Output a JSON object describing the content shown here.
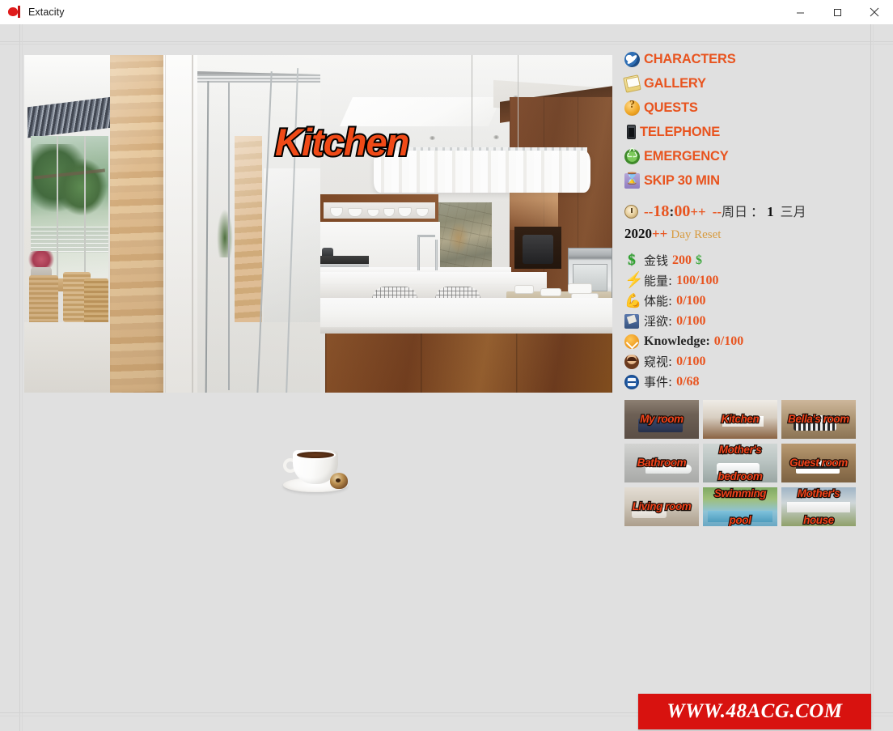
{
  "window": {
    "title": "Extacity",
    "icon": "app-logo-icon",
    "controls": {
      "minimize": "minimize-icon",
      "maximize": "maximize-icon",
      "close": "close-icon"
    }
  },
  "scene": {
    "title": "Kitchen",
    "image_alt": "modern kitchen interior with wood cabinets, marble island and outdoor patio"
  },
  "item": {
    "name": "coffee-cup",
    "alt": "cup of coffee on saucer with chocolate"
  },
  "menu": [
    {
      "id": "characters",
      "label": "CHARACTERS",
      "icon": "swirl-icon"
    },
    {
      "id": "gallery",
      "label": "GALLERY",
      "icon": "envelope-icon"
    },
    {
      "id": "quests",
      "label": "QUESTS",
      "icon": "question-mark-icon"
    },
    {
      "id": "telephone",
      "label": "TELEPHONE",
      "icon": "phone-icon"
    },
    {
      "id": "emergency",
      "label": "EMERGENCY",
      "icon": "recycle-icon"
    },
    {
      "id": "skip30",
      "label": "SKIP 30 MIN",
      "icon": "hourglass-icon"
    }
  ],
  "time": {
    "icon": "clock-icon",
    "hour_minus": "--",
    "hour": "18",
    "colon": ":",
    "minute": "00",
    "hour_plus": "++",
    "day_minus": "--",
    "weekday": "周日",
    "separator": "：",
    "day": "1",
    "month": "三月",
    "year": "2020",
    "year_plus": "++",
    "reset_label": "Day Reset"
  },
  "stats": [
    {
      "id": "money",
      "icon": "dollar-icon",
      "label": "金钱",
      "value": "200",
      "suffix": "$",
      "lang": "zh"
    },
    {
      "id": "energy",
      "icon": "bolt-icon",
      "label": "能量:",
      "value": "100/100",
      "suffix": "",
      "lang": "zh"
    },
    {
      "id": "fitness",
      "icon": "muscle-icon",
      "label": "体能:",
      "value": "0/100",
      "suffix": "",
      "lang": "zh"
    },
    {
      "id": "lust",
      "icon": "jeans-icon",
      "label": "淫欲:",
      "value": "0/100",
      "suffix": "",
      "lang": "zh"
    },
    {
      "id": "knowledge",
      "icon": "knowledge-icon",
      "label": "Knowledge:",
      "value": "0/100",
      "suffix": "",
      "lang": "en"
    },
    {
      "id": "peeping",
      "icon": "face-icon",
      "label": "窥视:",
      "value": "0/100",
      "suffix": "",
      "lang": "zh"
    },
    {
      "id": "events",
      "icon": "events-icon",
      "label": "事件:",
      "value": "0/68",
      "suffix": "",
      "lang": "zh"
    }
  ],
  "rooms": [
    {
      "id": "my-room",
      "label": "My room",
      "art": "bg-myroom",
      "lines": 1
    },
    {
      "id": "kitchen",
      "label": "Kitchen",
      "art": "bg-kitchen",
      "lines": 1
    },
    {
      "id": "bellas-room",
      "label": "Bella's room",
      "art": "bg-bella",
      "lines": 1
    },
    {
      "id": "bathroom",
      "label": "Bathroom",
      "art": "bg-bath",
      "lines": 1
    },
    {
      "id": "mothers-bedroom",
      "label": "Mother's",
      "label2": "bedroom",
      "art": "bg-mbed",
      "lines": 2
    },
    {
      "id": "guest-room",
      "label": "Guest room",
      "art": "bg-guest",
      "lines": 1
    },
    {
      "id": "living-room",
      "label": "Living room",
      "art": "bg-living",
      "lines": 1
    },
    {
      "id": "swimming-pool",
      "label": "Swimming",
      "label2": "pool",
      "art": "bg-pool",
      "lines": 2
    },
    {
      "id": "mothers-house",
      "label": "Mother's",
      "label2": "house",
      "art": "bg-mhouse",
      "lines": 2
    }
  ],
  "watermark": {
    "text": "WWW.48ACG.COM",
    "color": "#d8120f"
  },
  "colors": {
    "accent_orange": "#e8541f",
    "title_orange": "#f04a17",
    "room_label_red": "#f0421a",
    "money_green": "#3fa83f",
    "reset_gold": "#d79a3e",
    "window_bg": "#e0e0e0",
    "titlebar_bg": "#ffffff"
  }
}
